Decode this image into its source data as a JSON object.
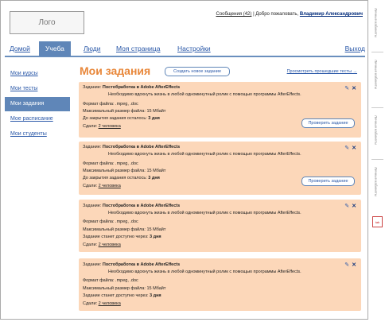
{
  "logo": {
    "text": "Лого"
  },
  "userbar": {
    "messages": "Сообщения (42)",
    "separator": "|",
    "welcome": "Добро пожаловать,",
    "user": "Владимир Александрович"
  },
  "nav": {
    "items": [
      "Домой",
      "Учеба",
      "Люди",
      "Моя страница",
      "Настройки"
    ],
    "active_index": 1,
    "logout": "Выход"
  },
  "sidebar": {
    "items": [
      "Мои курсы",
      "Мои тесты",
      "Мои задания",
      "Мое расписание",
      "Мои студенты"
    ],
    "active_index": 2
  },
  "main": {
    "title": "Мои задания",
    "create_button": "Создать новое задание",
    "preview_link": "Просмотреть прошедшие тесты →"
  },
  "cards": [
    {
      "task_label": "Задание:",
      "task_name": "Постобработка в Adobe AfterEffects",
      "description": "Необходимо вдохнуть жизнь в любой одноминутный ролик с помощью программы AfterEffects.",
      "format": "Формат файла: .mpeg, .doc",
      "max_size": "Максимальный размер файла: 15 Мбайт",
      "deadline_label": "До закрытия задания осталось:",
      "deadline_value": "3 дня",
      "submitted_label": "Сдали:",
      "submitted_value": "2 человека",
      "check_button": "Проверить задание"
    },
    {
      "task_label": "Задание:",
      "task_name": "Постобработка в Adobe AfterEffects",
      "description": "Необходимо вдохнуть жизнь в любой одноминутный ролик с помощью программы AfterEffects.",
      "format": "Формат файла: .mpeg, .doc",
      "max_size": "Максимальный размер файла: 15 Мбайт",
      "deadline_label": "До закрытия задания осталось:",
      "deadline_value": "3 дня",
      "submitted_label": "Сдали:",
      "submitted_value": "2 человека",
      "check_button": "Проверить задание"
    },
    {
      "task_label": "Задание:",
      "task_name": "Постобработка в Adobe AfterEffects",
      "description": "Необходимо вдохнуть жизнь в любой одноминутный ролик с помощью программы AfterEffects.",
      "format": "Формат файла: .mpeg, .doc",
      "max_size": "Максимальный размер файла: 15 Мбайт",
      "deadline_label": "Задание станет доступно через:",
      "deadline_value": "3 дня",
      "submitted_label": "Сдали:",
      "submitted_value": "2 человека"
    },
    {
      "task_label": "Задание:",
      "task_name": "Постобработка в Adobe AfterEffects",
      "description": "Необходимо вдохнуть жизнь в любой одноминутный ролик с помощью программы AfterEffects.",
      "format": "Формат файла: .mpeg, .doc",
      "max_size": "Максимальный размер файла: 15 Мбайт",
      "deadline_label": "Задание станет доступно через:",
      "deadline_value": "3 дня",
      "submitted_label": "Сдали:",
      "submitted_value": "2 человека"
    }
  ],
  "rail": {
    "labels": [
      "Личные кабинеты",
      "Личные кабинеты",
      "Личные кабинеты",
      "Личные кабинеты"
    ],
    "badge": "tab"
  },
  "colors": {
    "accent_orange": "#e8873a",
    "nav_blue": "#5f86b8",
    "card_bg": "#fcd7b9",
    "link_blue": "#2a58a8"
  }
}
